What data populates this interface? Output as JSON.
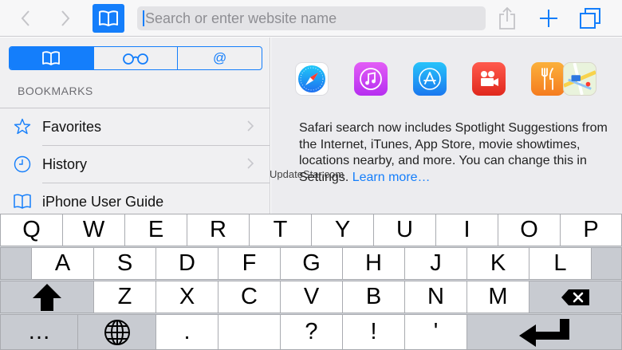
{
  "toolbar": {
    "address_placeholder": "Search or enter website name"
  },
  "sidebar": {
    "segments": [
      "book-icon",
      "glasses-icon",
      "@"
    ],
    "section_title": "BOOKMARKS",
    "items": [
      {
        "label": "Favorites",
        "icon": "star-icon"
      },
      {
        "label": "History",
        "icon": "clock-icon"
      },
      {
        "label": "iPhone User Guide",
        "icon": "book-icon"
      }
    ]
  },
  "suggestions": {
    "apps": [
      "safari-icon",
      "itunes-icon",
      "app-store-icon",
      "videos-icon",
      "restaurants-icon",
      "maps-icon"
    ],
    "text": "Safari search now includes Spotlight Suggestions from the Internet, iTunes, App Store, movie showtimes, locations nearby, and more. You can change this in Settings.",
    "learn_more": "Learn more…"
  },
  "watermark": "UpdateStar.com",
  "keyboard": {
    "row1": [
      "Q",
      "W",
      "E",
      "R",
      "T",
      "Y",
      "U",
      "I",
      "O",
      "P"
    ],
    "row2": [
      "A",
      "S",
      "D",
      "F",
      "G",
      "H",
      "J",
      "K",
      "L"
    ],
    "row3": [
      "Z",
      "X",
      "C",
      "V",
      "B",
      "N",
      "M"
    ],
    "row4": [
      "…",
      ".",
      "?",
      "!",
      "'"
    ]
  },
  "colors": {
    "accent": "#147efb",
    "keyboard_bg": "#d1d4d9"
  }
}
